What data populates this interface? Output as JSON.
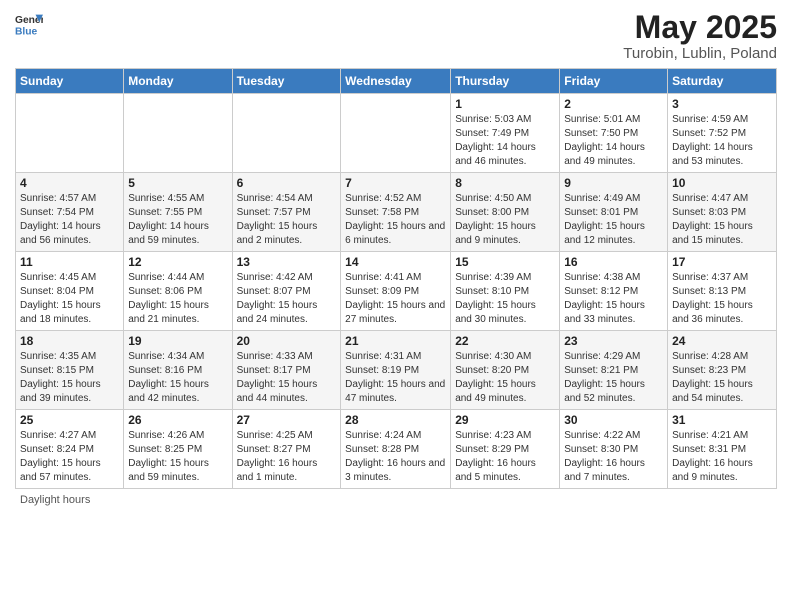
{
  "logo": {
    "general": "General",
    "blue": "Blue"
  },
  "title": {
    "month": "May 2025",
    "location": "Turobin, Lublin, Poland"
  },
  "weekdays": [
    "Sunday",
    "Monday",
    "Tuesday",
    "Wednesday",
    "Thursday",
    "Friday",
    "Saturday"
  ],
  "weeks": [
    [
      {
        "day": "",
        "sunrise": "",
        "sunset": "",
        "daylight": ""
      },
      {
        "day": "",
        "sunrise": "",
        "sunset": "",
        "daylight": ""
      },
      {
        "day": "",
        "sunrise": "",
        "sunset": "",
        "daylight": ""
      },
      {
        "day": "",
        "sunrise": "",
        "sunset": "",
        "daylight": ""
      },
      {
        "day": "1",
        "sunrise": "Sunrise: 5:03 AM",
        "sunset": "Sunset: 7:49 PM",
        "daylight": "Daylight: 14 hours and 46 minutes."
      },
      {
        "day": "2",
        "sunrise": "Sunrise: 5:01 AM",
        "sunset": "Sunset: 7:50 PM",
        "daylight": "Daylight: 14 hours and 49 minutes."
      },
      {
        "day": "3",
        "sunrise": "Sunrise: 4:59 AM",
        "sunset": "Sunset: 7:52 PM",
        "daylight": "Daylight: 14 hours and 53 minutes."
      }
    ],
    [
      {
        "day": "4",
        "sunrise": "Sunrise: 4:57 AM",
        "sunset": "Sunset: 7:54 PM",
        "daylight": "Daylight: 14 hours and 56 minutes."
      },
      {
        "day": "5",
        "sunrise": "Sunrise: 4:55 AM",
        "sunset": "Sunset: 7:55 PM",
        "daylight": "Daylight: 14 hours and 59 minutes."
      },
      {
        "day": "6",
        "sunrise": "Sunrise: 4:54 AM",
        "sunset": "Sunset: 7:57 PM",
        "daylight": "Daylight: 15 hours and 2 minutes."
      },
      {
        "day": "7",
        "sunrise": "Sunrise: 4:52 AM",
        "sunset": "Sunset: 7:58 PM",
        "daylight": "Daylight: 15 hours and 6 minutes."
      },
      {
        "day": "8",
        "sunrise": "Sunrise: 4:50 AM",
        "sunset": "Sunset: 8:00 PM",
        "daylight": "Daylight: 15 hours and 9 minutes."
      },
      {
        "day": "9",
        "sunrise": "Sunrise: 4:49 AM",
        "sunset": "Sunset: 8:01 PM",
        "daylight": "Daylight: 15 hours and 12 minutes."
      },
      {
        "day": "10",
        "sunrise": "Sunrise: 4:47 AM",
        "sunset": "Sunset: 8:03 PM",
        "daylight": "Daylight: 15 hours and 15 minutes."
      }
    ],
    [
      {
        "day": "11",
        "sunrise": "Sunrise: 4:45 AM",
        "sunset": "Sunset: 8:04 PM",
        "daylight": "Daylight: 15 hours and 18 minutes."
      },
      {
        "day": "12",
        "sunrise": "Sunrise: 4:44 AM",
        "sunset": "Sunset: 8:06 PM",
        "daylight": "Daylight: 15 hours and 21 minutes."
      },
      {
        "day": "13",
        "sunrise": "Sunrise: 4:42 AM",
        "sunset": "Sunset: 8:07 PM",
        "daylight": "Daylight: 15 hours and 24 minutes."
      },
      {
        "day": "14",
        "sunrise": "Sunrise: 4:41 AM",
        "sunset": "Sunset: 8:09 PM",
        "daylight": "Daylight: 15 hours and 27 minutes."
      },
      {
        "day": "15",
        "sunrise": "Sunrise: 4:39 AM",
        "sunset": "Sunset: 8:10 PM",
        "daylight": "Daylight: 15 hours and 30 minutes."
      },
      {
        "day": "16",
        "sunrise": "Sunrise: 4:38 AM",
        "sunset": "Sunset: 8:12 PM",
        "daylight": "Daylight: 15 hours and 33 minutes."
      },
      {
        "day": "17",
        "sunrise": "Sunrise: 4:37 AM",
        "sunset": "Sunset: 8:13 PM",
        "daylight": "Daylight: 15 hours and 36 minutes."
      }
    ],
    [
      {
        "day": "18",
        "sunrise": "Sunrise: 4:35 AM",
        "sunset": "Sunset: 8:15 PM",
        "daylight": "Daylight: 15 hours and 39 minutes."
      },
      {
        "day": "19",
        "sunrise": "Sunrise: 4:34 AM",
        "sunset": "Sunset: 8:16 PM",
        "daylight": "Daylight: 15 hours and 42 minutes."
      },
      {
        "day": "20",
        "sunrise": "Sunrise: 4:33 AM",
        "sunset": "Sunset: 8:17 PM",
        "daylight": "Daylight: 15 hours and 44 minutes."
      },
      {
        "day": "21",
        "sunrise": "Sunrise: 4:31 AM",
        "sunset": "Sunset: 8:19 PM",
        "daylight": "Daylight: 15 hours and 47 minutes."
      },
      {
        "day": "22",
        "sunrise": "Sunrise: 4:30 AM",
        "sunset": "Sunset: 8:20 PM",
        "daylight": "Daylight: 15 hours and 49 minutes."
      },
      {
        "day": "23",
        "sunrise": "Sunrise: 4:29 AM",
        "sunset": "Sunset: 8:21 PM",
        "daylight": "Daylight: 15 hours and 52 minutes."
      },
      {
        "day": "24",
        "sunrise": "Sunrise: 4:28 AM",
        "sunset": "Sunset: 8:23 PM",
        "daylight": "Daylight: 15 hours and 54 minutes."
      }
    ],
    [
      {
        "day": "25",
        "sunrise": "Sunrise: 4:27 AM",
        "sunset": "Sunset: 8:24 PM",
        "daylight": "Daylight: 15 hours and 57 minutes."
      },
      {
        "day": "26",
        "sunrise": "Sunrise: 4:26 AM",
        "sunset": "Sunset: 8:25 PM",
        "daylight": "Daylight: 15 hours and 59 minutes."
      },
      {
        "day": "27",
        "sunrise": "Sunrise: 4:25 AM",
        "sunset": "Sunset: 8:27 PM",
        "daylight": "Daylight: 16 hours and 1 minute."
      },
      {
        "day": "28",
        "sunrise": "Sunrise: 4:24 AM",
        "sunset": "Sunset: 8:28 PM",
        "daylight": "Daylight: 16 hours and 3 minutes."
      },
      {
        "day": "29",
        "sunrise": "Sunrise: 4:23 AM",
        "sunset": "Sunset: 8:29 PM",
        "daylight": "Daylight: 16 hours and 5 minutes."
      },
      {
        "day": "30",
        "sunrise": "Sunrise: 4:22 AM",
        "sunset": "Sunset: 8:30 PM",
        "daylight": "Daylight: 16 hours and 7 minutes."
      },
      {
        "day": "31",
        "sunrise": "Sunrise: 4:21 AM",
        "sunset": "Sunset: 8:31 PM",
        "daylight": "Daylight: 16 hours and 9 minutes."
      }
    ]
  ],
  "footer": {
    "note": "Daylight hours"
  }
}
